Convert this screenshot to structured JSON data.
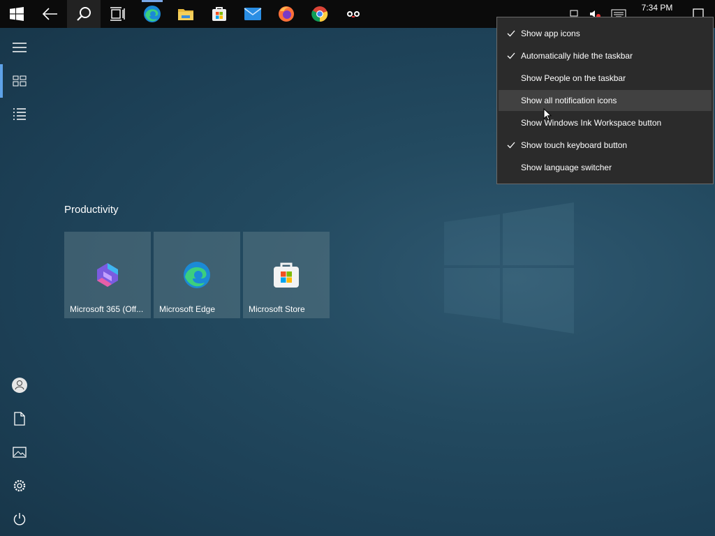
{
  "taskbar": {
    "items": [
      {
        "name": "start-button"
      },
      {
        "name": "back-button"
      },
      {
        "name": "search-button"
      },
      {
        "name": "task-view-button"
      },
      {
        "name": "edge-taskbar-icon"
      },
      {
        "name": "file-explorer-taskbar-icon"
      },
      {
        "name": "store-taskbar-icon"
      },
      {
        "name": "mail-taskbar-icon"
      },
      {
        "name": "firefox-taskbar-icon"
      },
      {
        "name": "chrome-taskbar-icon"
      },
      {
        "name": "app-taskbar-icon"
      }
    ],
    "clock": "7:34 PM"
  },
  "rail": {
    "items": [
      "menu-icon",
      "all-tiles-icon",
      "all-apps-icon",
      "user-icon",
      "documents-icon",
      "pictures-icon",
      "settings-icon",
      "power-icon"
    ]
  },
  "start": {
    "group_title": "Productivity",
    "tiles": [
      {
        "label": "Microsoft 365 (Off..."
      },
      {
        "label": "Microsoft Edge"
      },
      {
        "label": "Microsoft Store"
      }
    ]
  },
  "context_menu": {
    "items": [
      {
        "label": "Show app icons",
        "checked": true
      },
      {
        "label": "Automatically hide the taskbar",
        "checked": true
      },
      {
        "label": "Show People on the taskbar",
        "checked": false
      },
      {
        "label": "Show all notification icons",
        "checked": false
      },
      {
        "label": "Show Windows Ink Workspace button",
        "checked": false
      },
      {
        "label": "Show touch keyboard button",
        "checked": true
      },
      {
        "label": "Show language switcher",
        "checked": false
      }
    ]
  },
  "colors": {
    "accent": "#5ea2e8",
    "menu_bg": "#2b2b2b",
    "menu_hover": "#414141",
    "taskbar": "#0b0b0b"
  }
}
